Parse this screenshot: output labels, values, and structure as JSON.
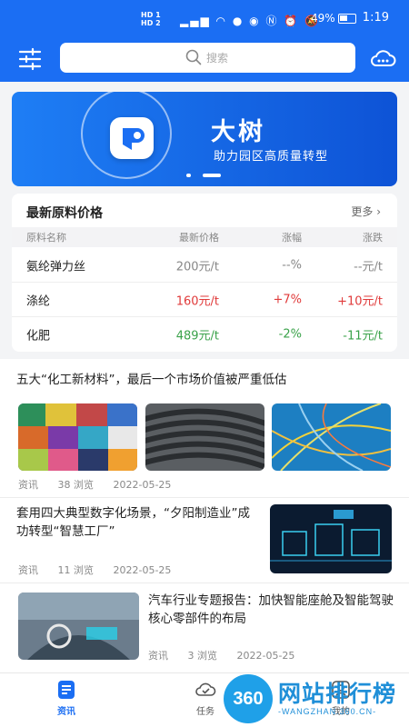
{
  "status_bar": {
    "network_top": "HD 1",
    "network_bottom": "HD 2",
    "battery": "49%",
    "time": "1:19"
  },
  "header": {
    "search_placeholder": "搜索",
    "left_icon": "filter-sliders-icon",
    "right_icon": "cloud-icon"
  },
  "banner": {
    "title": "大树",
    "subtitle": "助力园区高质量转型",
    "slide_count": 2,
    "active_slide": 2
  },
  "price_section": {
    "title": "最新原料价格",
    "more_label": "更多",
    "headers": [
      "原料名称",
      "最新价格",
      "涨幅",
      "涨跌"
    ],
    "rows": [
      {
        "name": "氨纶弹力丝",
        "price": "200元/t",
        "change_pct": "--%",
        "change_amt": "--元/t",
        "trend": "none"
      },
      {
        "name": "涤纶",
        "price": "160元/t",
        "change_pct": "+7%",
        "change_amt": "+10元/t",
        "trend": "up"
      },
      {
        "name": "化肥",
        "price": "489元/t",
        "change_pct": "-2%",
        "change_amt": "-11元/t",
        "trend": "down"
      }
    ],
    "colors": {
      "up": "#e03a3a",
      "down": "#3aa24a",
      "none": "#888888"
    }
  },
  "news": [
    {
      "title": "五大“化工新材料”，最后一个市场价值被严重低估",
      "category": "资讯",
      "views": "38 浏览",
      "date": "2022-05-25",
      "images": [
        "colorful-plastic-pellets",
        "cable-coils",
        "glowing-fibers"
      ]
    },
    {
      "title": "套用四大典型数字化场景，“夕阳制造业”成功转型“智慧工厂”",
      "category": "资讯",
      "views": "11 浏览",
      "date": "2022-05-25",
      "images": [
        "digital-factory"
      ]
    },
    {
      "title": "汽车行业专题报告：加快智能座舱及智能驾驶核心零部件的布局",
      "category": "资讯",
      "views": "3 浏览",
      "date": "2022-05-25",
      "images": [
        "smart-cockpit"
      ]
    }
  ],
  "bottom_nav": [
    {
      "label": "资讯",
      "icon": "news-icon",
      "active": true
    },
    {
      "label": "任务",
      "icon": "task-cloud-icon",
      "active": false
    },
    {
      "label": "我的",
      "icon": "profile-icon",
      "active": false
    }
  ],
  "watermark": {
    "badge": "360",
    "text": "网站排行榜",
    "url": "-WANGZHAN.360.CN-"
  },
  "theme": {
    "primary": "#1b6ef3"
  }
}
